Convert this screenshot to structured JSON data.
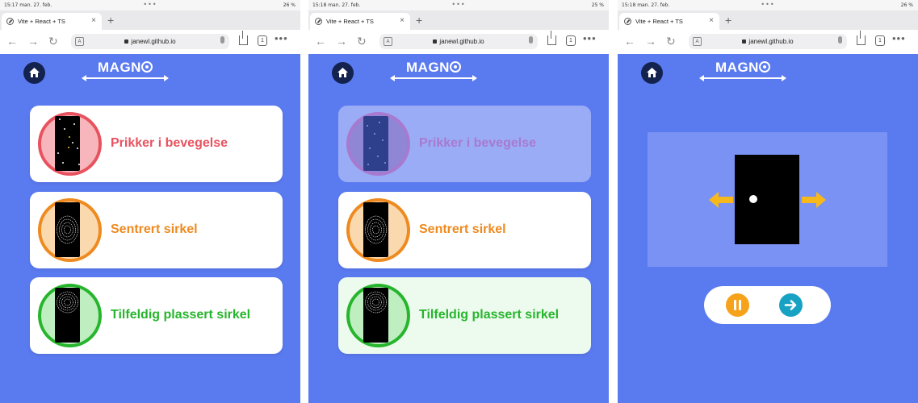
{
  "screens": [
    {
      "status": {
        "time": "15:17  man. 27. feb.",
        "dots": "•••",
        "right": "26 %"
      },
      "tab": {
        "title": "Vite + React + TS",
        "close": "×"
      },
      "address": {
        "url": "janewl.github.io",
        "tabs_count": "1"
      },
      "logo": "MAGN",
      "cards": [
        {
          "label": "Prikker i bevegelse",
          "state": "normal"
        },
        {
          "label": "Sentrert sirkel",
          "state": "normal"
        },
        {
          "label": "Tilfeldig plassert sirkel",
          "state": "normal"
        }
      ]
    },
    {
      "status": {
        "time": "15:18  man. 27. feb.",
        "dots": "•••",
        "right": "25 %"
      },
      "tab": {
        "title": "Vite + React + TS",
        "close": "×"
      },
      "address": {
        "url": "janewl.github.io",
        "tabs_count": "1"
      },
      "logo": "MAGN",
      "cards": [
        {
          "label": "Prikker i bevegelse",
          "state": "disabled"
        },
        {
          "label": "Sentrert sirkel",
          "state": "normal"
        },
        {
          "label": "Tilfeldig plassert sirkel",
          "state": "selected"
        }
      ]
    },
    {
      "status": {
        "time": "15:18  man. 27. feb.",
        "dots": "•••",
        "right": "26 %"
      },
      "tab": {
        "title": "Vite + React + TS",
        "close": "×"
      },
      "address": {
        "url": "janewl.github.io",
        "tabs_count": "1"
      },
      "logo": "MAGN",
      "player": {
        "pause_icon": "pause-icon",
        "next_icon": "arrow-right-icon"
      }
    }
  ],
  "colors": {
    "background": "#5a7af0",
    "card_red": "#e8525f",
    "card_orange": "#ee8a1f",
    "card_green": "#26b52c",
    "home_button": "#13224e",
    "pause_button": "#f7a21b",
    "next_button": "#17a2c4",
    "arrows": "#f7b81b"
  }
}
